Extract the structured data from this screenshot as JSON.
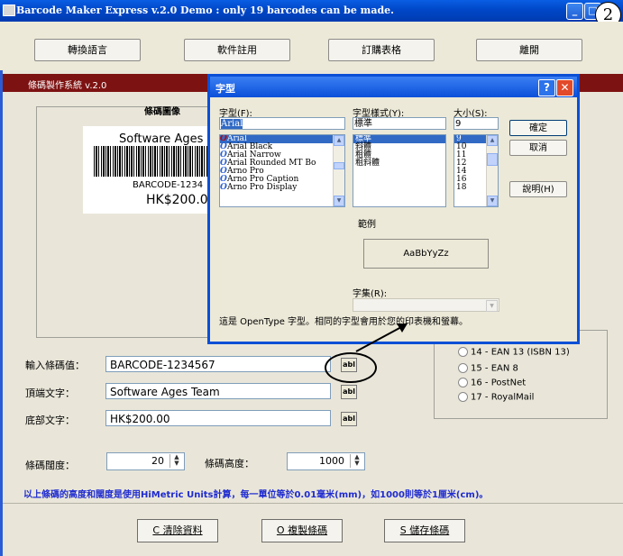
{
  "window": {
    "title": "Barcode Maker Express v.2.0 Demo : only 19 barcodes can be made.",
    "step_badge": "2"
  },
  "menu": {
    "items": [
      "轉換語言",
      "軟件註用",
      "訂購表格",
      "離開"
    ]
  },
  "system_bar": {
    "label": "條碼製作系統 v.2.0"
  },
  "preview": {
    "group_title": "條碼圖像",
    "top_text": "Software Ages",
    "code_text": "BARCODE-1234",
    "bottom_text": "HK$200.0"
  },
  "form": {
    "barcode_label": "輸入條碼值：",
    "barcode_value": "BARCODE-1234567",
    "top_label": "頂端文字：",
    "top_value": "Software Ages Team",
    "bottom_label": "底部文字：",
    "bottom_value": "HK$200.00",
    "font_button_icon": "abl",
    "width_label": "條碼闊度：",
    "width_value": "20",
    "height_label": "條碼高度：",
    "height_value": "1000"
  },
  "barcode_types": [
    {
      "label": "14 - EAN 13 (ISBN 13)"
    },
    {
      "label": "15 - EAN 8"
    },
    {
      "label": "16 - PostNet"
    },
    {
      "label": "17 - RoyalMail"
    }
  ],
  "note": "以上條碼的高度和闊度是使用HiMetric Units計算，每一單位等於0.01毫米(mm)，如1000則等於1厘米(cm)。",
  "buttons": {
    "clear": "C 清除資料",
    "copy": "O 複製條碼",
    "save": "S 儲存條碼"
  },
  "font_dialog": {
    "title": "字型",
    "help_icon": "?",
    "close_icon": "✕",
    "font_label": "字型(F):",
    "font_value": "Arial",
    "fonts": [
      "Arial",
      "Arial Black",
      "Arial Narrow",
      "Arial Rounded MT Bo",
      "Arno Pro",
      "Arno Pro Caption",
      "Arno Pro Display"
    ],
    "style_label": "字型樣式(Y):",
    "style_value": "標準",
    "styles": [
      "標準",
      "斜體",
      "粗體",
      "粗斜體"
    ],
    "size_label": "大小(S):",
    "size_value": "9",
    "sizes": [
      "9",
      "10",
      "11",
      "12",
      "14",
      "16",
      "18"
    ],
    "ok": "確定",
    "cancel": "取消",
    "help_button": "說明(H)",
    "sample_label": "範例",
    "sample_text": "AaBbYyZz",
    "charset_label": "字集(R):",
    "description": "這是 OpenType 字型。相同的字型會用於您的印表機和螢幕。"
  }
}
